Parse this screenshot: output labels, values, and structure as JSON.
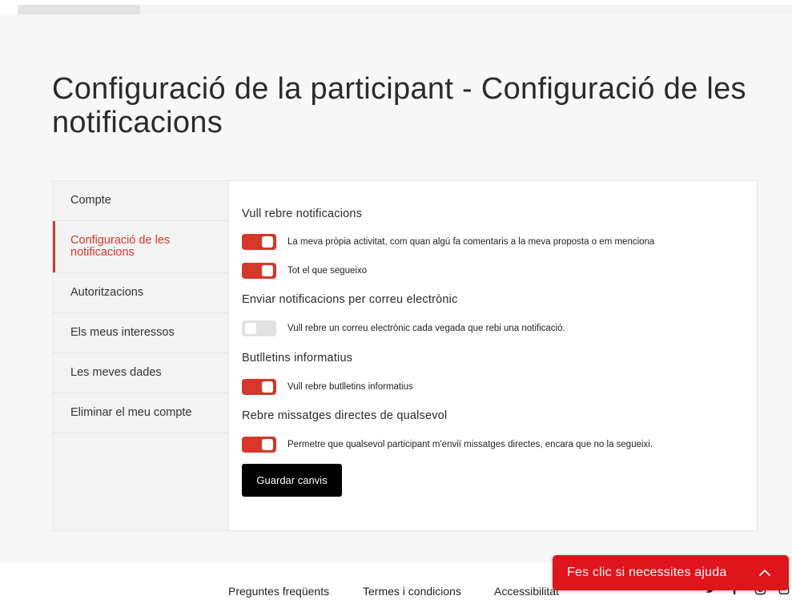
{
  "page": {
    "title": "Configuració de la participant - Configuració de les notificacions"
  },
  "sidebar": {
    "items": [
      {
        "label": "Compte"
      },
      {
        "label": "Configuració de les notificacions",
        "active": true
      },
      {
        "label": "Autoritzacions"
      },
      {
        "label": "Els meus interessos"
      },
      {
        "label": "Les meves dades"
      },
      {
        "label": "Eliminar el meu compte"
      }
    ]
  },
  "settings": {
    "notifications_heading": "Vull rebre notificacions",
    "own_activity": {
      "label": "La meva pròpia activitat, com quan algú fa comentaris a la meva proposta o em menciona",
      "enabled": true
    },
    "following": {
      "label": "Tot el que segueixo",
      "enabled": true
    },
    "email_heading": "Enviar notificacions per correu electrònic",
    "email_each": {
      "label": "Vull rebre un correu electrònic cada vegada que rebi una notificació.",
      "enabled": false
    },
    "newsletter_heading": "Butlletins informatius",
    "newsletter": {
      "label": "Vull rebre butlletins informatius",
      "enabled": true
    },
    "direct_heading": "Rebre missatges directes de qualsevol",
    "direct_messages": {
      "label": "Permetre que qualsevol participant m'enviï missatges directes, encara que no la segueixi.",
      "enabled": true
    },
    "save_label": "Guardar canvis"
  },
  "footer": {
    "faq": "Preguntes freqüents",
    "terms": "Termes i condicions",
    "accessibility": "Accessibilitat",
    "social_icons": [
      "twitter-icon",
      "facebook-icon",
      "instagram-icon",
      "youtube-icon"
    ]
  },
  "help_widget": {
    "label": "Fes clic si necessites ajuda"
  },
  "colors": {
    "accent": "#d6372a",
    "toggle_off": "#e2e2e2",
    "help_bg": "#e0141b",
    "button_bg": "#000000"
  }
}
